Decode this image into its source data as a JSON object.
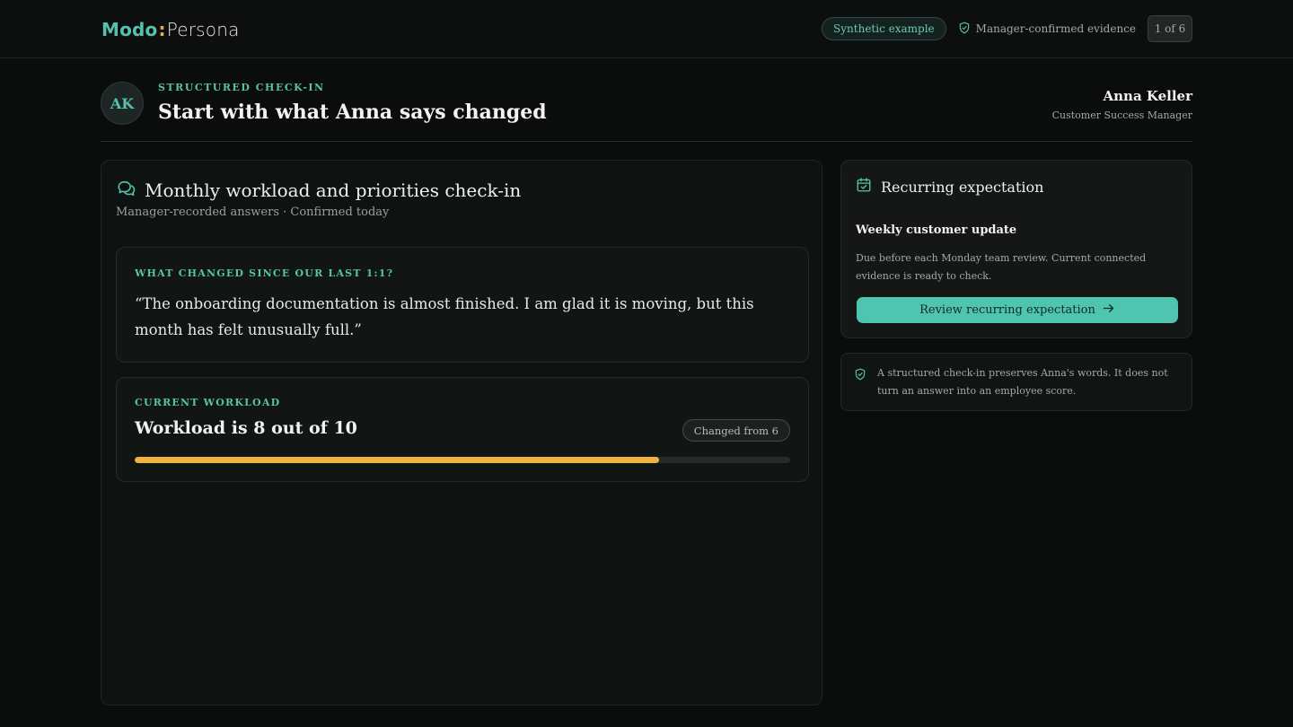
{
  "app": {
    "logo_part1": "Modo",
    "logo_colon": ":",
    "logo_part2": "Persona",
    "synthetic_badge": "Synthetic example",
    "evidence_label": "Manager-confirmed evidence",
    "counter": "1 of 6"
  },
  "header": {
    "avatar_initials": "AK",
    "eyebrow": "STRUCTURED CHECK-IN",
    "title": "Start with what Anna says changed",
    "person_name": "Anna Keller",
    "person_role": "Customer Success Manager"
  },
  "checkin": {
    "icon": "chat-bubbles-icon",
    "title": "Monthly workload and priorities check-in",
    "subtitle": "Manager-recorded answers · Confirmed today",
    "question_label": "WHAT CHANGED SINCE OUR LAST 1:1?",
    "answer_quote": "“The onboarding documentation is almost finished. I am glad it is moving, but this month has felt unusually full.”",
    "workload_label": "CURRENT WORKLOAD",
    "workload_value": "Workload is 8 out of 10",
    "workload_changed": "Changed from 6",
    "workload_score": 8,
    "workload_max": 10
  },
  "expectation": {
    "icon": "calendar-check-icon",
    "heading": "Recurring expectation",
    "name": "Weekly customer update",
    "description": "Due before each Monday team review. Current connected evidence is ready to check.",
    "button_label": "Review recurring expectation",
    "button_icon": "arrow-right-icon"
  },
  "note": {
    "icon": "shield-check-icon",
    "text": "A structured check-in preserves Anna's words. It does not turn an answer into an employee score."
  },
  "colors": {
    "accent": "#57c2ab",
    "workload_bar": "#f0b23e",
    "button": "#4fc5b0"
  }
}
